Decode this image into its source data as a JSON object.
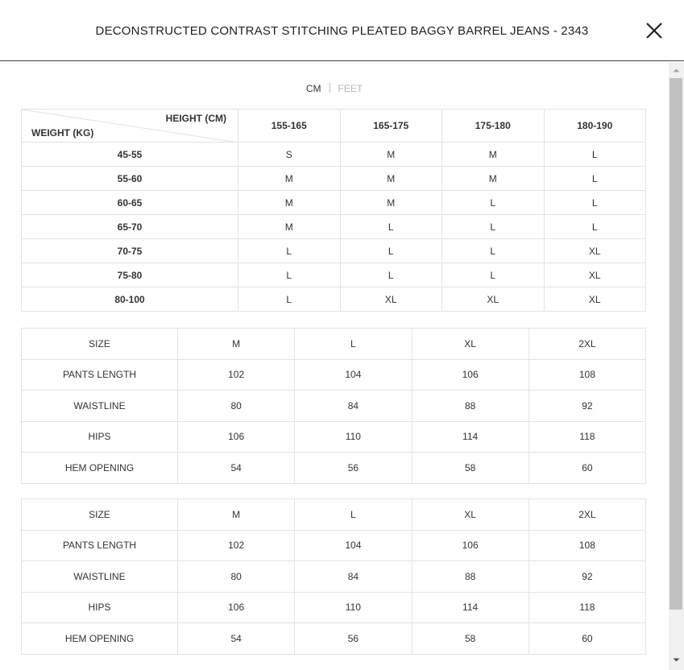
{
  "modal": {
    "title": "DECONSTRUCTED CONTRAST STITCHING PLEATED BAGGY BARREL JEANS - 2343",
    "close_label": "×"
  },
  "unit_tabs": {
    "cm": "CM",
    "feet": "FEET",
    "active": "CM"
  },
  "size_chart": {
    "height_label": "HEIGHT (CM)",
    "weight_label": "WEIGHT (KG)",
    "height_ranges": [
      "155-165",
      "165-175",
      "175-180",
      "180-190"
    ],
    "rows": [
      {
        "weight": "45-55",
        "sizes": [
          "S",
          "M",
          "M",
          "L"
        ]
      },
      {
        "weight": "55-60",
        "sizes": [
          "M",
          "M",
          "M",
          "L"
        ]
      },
      {
        "weight": "60-65",
        "sizes": [
          "M",
          "M",
          "L",
          "L"
        ]
      },
      {
        "weight": "65-70",
        "sizes": [
          "M",
          "L",
          "L",
          "L"
        ]
      },
      {
        "weight": "70-75",
        "sizes": [
          "L",
          "L",
          "L",
          "XL"
        ]
      },
      {
        "weight": "75-80",
        "sizes": [
          "L",
          "L",
          "L",
          "XL"
        ]
      },
      {
        "weight": "80-100",
        "sizes": [
          "L",
          "XL",
          "XL",
          "XL"
        ]
      }
    ]
  },
  "measurement_tables": [
    {
      "rows": [
        [
          "SIZE",
          "M",
          "L",
          "XL",
          "2XL"
        ],
        [
          "PANTS LENGTH",
          "102",
          "104",
          "106",
          "108"
        ],
        [
          "WAISTLINE",
          "80",
          "84",
          "88",
          "92"
        ],
        [
          "HIPS",
          "106",
          "110",
          "114",
          "118"
        ],
        [
          "HEM OPENING",
          "54",
          "56",
          "58",
          "60"
        ]
      ]
    },
    {
      "rows": [
        [
          "SIZE",
          "M",
          "L",
          "XL",
          "2XL"
        ],
        [
          "PANTS LENGTH",
          "102",
          "104",
          "106",
          "108"
        ],
        [
          "WAISTLINE",
          "80",
          "84",
          "88",
          "92"
        ],
        [
          "HIPS",
          "106",
          "110",
          "114",
          "118"
        ],
        [
          "HEM OPENING",
          "54",
          "56",
          "58",
          "60"
        ]
      ]
    }
  ],
  "icons": {
    "close": "close-icon",
    "scroll_up": "chevron-up-icon",
    "scroll_down": "chevron-down-icon"
  }
}
